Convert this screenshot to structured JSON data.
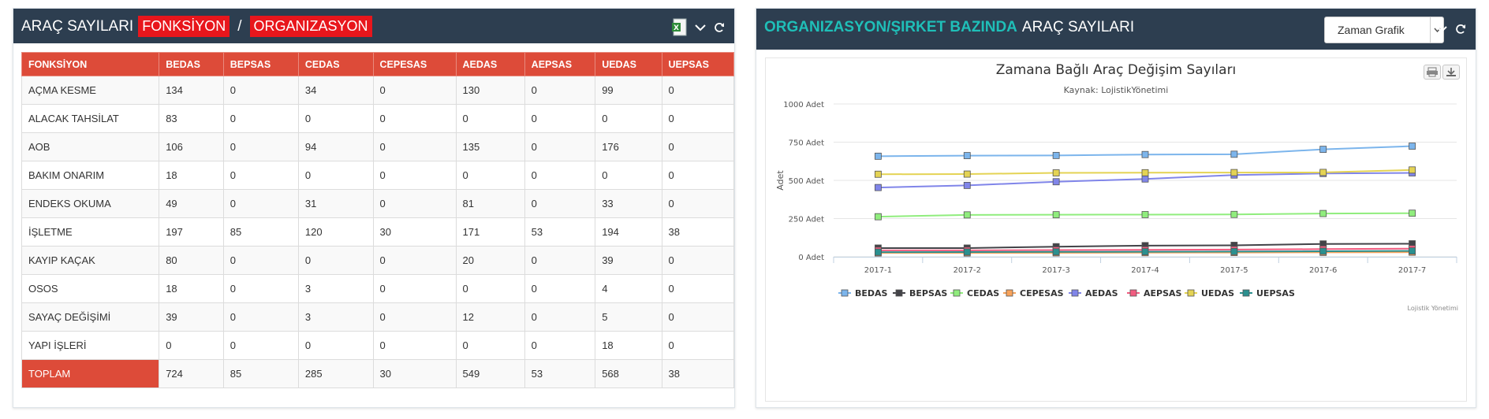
{
  "left_panel": {
    "title_prefix": "ARAÇ SAYILARI",
    "tab_fonksiyon": "FONKSİYON",
    "separator": "/",
    "tab_organizasyon": "ORGANIZASYON",
    "icons": [
      "excel-export-icon",
      "chevron-down-icon",
      "refresh-icon"
    ]
  },
  "table": {
    "columns": [
      "FONKSİYON",
      "BEDAS",
      "BEPSAS",
      "CEDAS",
      "CEPESAS",
      "AEDAS",
      "AEPSAS",
      "UEDAS",
      "UEPSAS"
    ],
    "rows": [
      [
        "AÇMA KESME",
        "134",
        "0",
        "34",
        "0",
        "130",
        "0",
        "99",
        "0"
      ],
      [
        "ALACAK TAHSİLAT",
        "83",
        "0",
        "0",
        "0",
        "0",
        "0",
        "0",
        "0"
      ],
      [
        "AOB",
        "106",
        "0",
        "94",
        "0",
        "135",
        "0",
        "176",
        "0"
      ],
      [
        "BAKIM ONARIM",
        "18",
        "0",
        "0",
        "0",
        "0",
        "0",
        "0",
        "0"
      ],
      [
        "ENDEKS OKUMA",
        "49",
        "0",
        "31",
        "0",
        "81",
        "0",
        "33",
        "0"
      ],
      [
        "İŞLETME",
        "197",
        "85",
        "120",
        "30",
        "171",
        "53",
        "194",
        "38"
      ],
      [
        "KAYIP KAÇAK",
        "80",
        "0",
        "0",
        "0",
        "20",
        "0",
        "39",
        "0"
      ],
      [
        "OSOS",
        "18",
        "0",
        "3",
        "0",
        "0",
        "0",
        "4",
        "0"
      ],
      [
        "SAYAÇ DEĞİŞİMİ",
        "39",
        "0",
        "3",
        "0",
        "12",
        "0",
        "5",
        "0"
      ],
      [
        "YAPI İŞLERİ",
        "0",
        "0",
        "0",
        "0",
        "0",
        "0",
        "18",
        "0"
      ]
    ],
    "total": [
      "TOPLAM",
      "724",
      "85",
      "285",
      "30",
      "549",
      "53",
      "568",
      "38"
    ]
  },
  "right_panel": {
    "title_highlight": "ORGANIZASYON/ŞIRKET BAZINDA",
    "title_rest": "ARAÇ SAYILARI",
    "select_value": "Zaman Grafik",
    "icons": [
      "chevron-down-icon",
      "refresh-icon"
    ]
  },
  "chart_data": {
    "type": "line",
    "title": "Zamana Bağlı Araç Değişim Sayıları",
    "subtitle": "Kaynak: LojistikYönetimi",
    "ylabel": "Adet",
    "xlabel": "",
    "credits": "Lojistik Yönetimi",
    "categories": [
      "2017-1",
      "2017-2",
      "2017-3",
      "2017-4",
      "2017-5",
      "2017-6",
      "2017-7"
    ],
    "ylim": [
      0,
      1000
    ],
    "yticks": [
      0,
      250,
      500,
      750,
      1000
    ],
    "ytick_labels": [
      "0 Adet",
      "250 Adet",
      "500 Adet",
      "750 Adet",
      "1000 Adet"
    ],
    "grid": true,
    "legend_position": "bottom",
    "series": [
      {
        "name": "BEDAS",
        "color": "#7cb5ec",
        "marker_fill": "#7cb5ec",
        "values": [
          658,
          662,
          663,
          669,
          671,
          703,
          724
        ]
      },
      {
        "name": "BEPSAS",
        "color": "#434348",
        "marker_fill": "#434348",
        "values": [
          57,
          57,
          66,
          73,
          75,
          84,
          85
        ]
      },
      {
        "name": "CEDAS",
        "color": "#90ed7d",
        "marker_fill": "#90ed7d",
        "values": [
          262,
          274,
          275,
          276,
          277,
          283,
          285
        ]
      },
      {
        "name": "CEPESAS",
        "color": "#f7a35c",
        "marker_fill": "#f7a35c",
        "values": [
          25,
          25,
          26,
          27,
          28,
          29,
          30
        ]
      },
      {
        "name": "AEDAS",
        "color": "#8085e9",
        "marker_fill": "#8085e9",
        "values": [
          453,
          467,
          491,
          509,
          535,
          545,
          549
        ]
      },
      {
        "name": "AEPSAS",
        "color": "#f15c80",
        "marker_fill": "#f15c80",
        "values": [
          42,
          42,
          44,
          45,
          47,
          50,
          53
        ]
      },
      {
        "name": "UEDAS",
        "color": "#e4d354",
        "marker_fill": "#e4d354",
        "values": [
          540,
          541,
          549,
          550,
          551,
          552,
          568
        ]
      },
      {
        "name": "UEPSAS",
        "color": "#2b908f",
        "marker_fill": "#2b908f",
        "values": [
          30,
          31,
          32,
          33,
          34,
          36,
          38
        ]
      }
    ]
  }
}
